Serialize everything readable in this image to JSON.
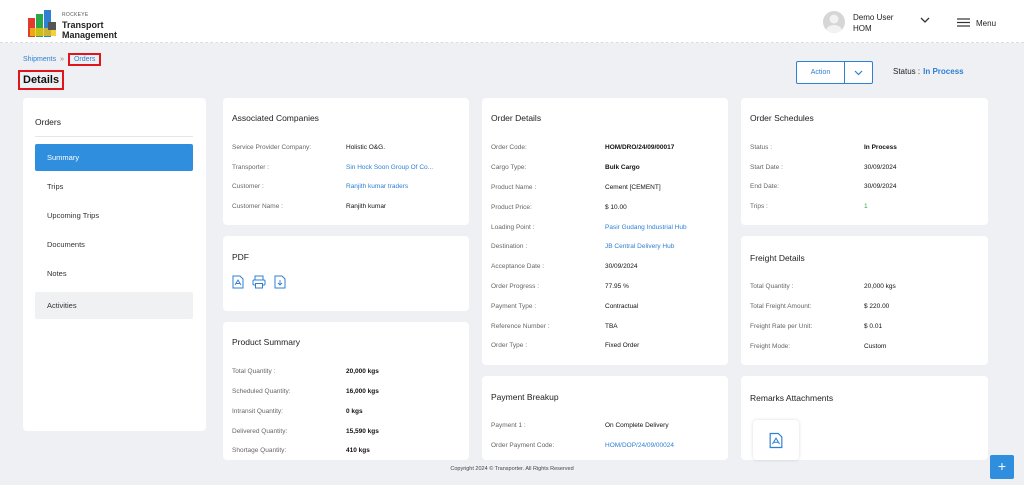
{
  "app": {
    "brand_small": "ROCKEYE",
    "brand_line1": "Transport",
    "brand_line2": "Management"
  },
  "user": {
    "name": "Demo User",
    "role": "HOM",
    "menu_label": "Menu"
  },
  "breadcrumb": {
    "root": "Shipments",
    "separator": "»",
    "current": "Orders"
  },
  "page": {
    "title": "Details",
    "action_label": "Action",
    "status_label": "Status :",
    "status_value": "In Process"
  },
  "sidebar": {
    "heading": "Orders",
    "items": [
      {
        "label": "Summary"
      },
      {
        "label": "Trips"
      },
      {
        "label": "Upcoming Trips"
      },
      {
        "label": "Documents"
      },
      {
        "label": "Notes"
      },
      {
        "label": "Activities"
      }
    ]
  },
  "associated": {
    "title": "Associated Companies",
    "rows": [
      {
        "label": "Service Provider Company:",
        "value": "Holistic O&G."
      },
      {
        "label": "Transporter :",
        "value": "Sin Hock Soon Group Of Co..."
      },
      {
        "label": "Customer :",
        "value": "Ranjith kumar traders"
      },
      {
        "label": "Customer Name :",
        "value": "Ranjith kumar"
      }
    ]
  },
  "pdf": {
    "title": "PDF"
  },
  "product_summary": {
    "title": "Product Summary",
    "rows": [
      {
        "label": "Total Quantity :",
        "value": "20,000 kgs"
      },
      {
        "label": "Scheduled Quantity:",
        "value": "16,000 kgs"
      },
      {
        "label": "Intransit Quantity:",
        "value": "0 kgs"
      },
      {
        "label": "Delivered Quantity:",
        "value": "15,590 kgs"
      },
      {
        "label": "Shortage Quantity:",
        "value": "410 kgs"
      }
    ]
  },
  "order_details": {
    "title": "Order Details",
    "rows": [
      {
        "label": "Order Code:",
        "value": "HOM/DRO/24/09/00017"
      },
      {
        "label": "Cargo Type:",
        "value": "Bulk Cargo"
      },
      {
        "label": "Product Name :",
        "value": "Cement [CEMENT]"
      },
      {
        "label": "Product Price:",
        "value": "$ 10.00"
      },
      {
        "label": "Loading Point :",
        "value": "Pasir Gudang Industrial Hub"
      },
      {
        "label": "Destination :",
        "value": "JB Central Delivery Hub"
      },
      {
        "label": "Acceptance Date :",
        "value": "30/09/2024"
      },
      {
        "label": "Order Progress :",
        "value": "77.95 %"
      },
      {
        "label": "Payment Type :",
        "value": "Contractual"
      },
      {
        "label": "Reference Number :",
        "value": "TBA"
      },
      {
        "label": "Order Type :",
        "value": "Fixed Order"
      }
    ]
  },
  "payment_breakup": {
    "title": "Payment Breakup",
    "rows": [
      {
        "label": "Payment 1 :",
        "value": "On Complete Delivery"
      },
      {
        "label": "Order Payment Code:",
        "value": "HOM/DOP/24/09/00024"
      }
    ]
  },
  "order_schedules": {
    "title": "Order Schedules",
    "rows": [
      {
        "label": "Status :",
        "value": "In Process"
      },
      {
        "label": "Start Date :",
        "value": "30/09/2024"
      },
      {
        "label": "End Date:",
        "value": "30/09/2024"
      },
      {
        "label": "Trips :",
        "value": "1"
      }
    ]
  },
  "freight_details": {
    "title": "Freight Details",
    "rows": [
      {
        "label": "Total Quantity :",
        "value": "20,000 kgs"
      },
      {
        "label": "Total Freight Amount:",
        "value": "$ 220.00"
      },
      {
        "label": "Freight Rate per Unit:",
        "value": "$ 0.01"
      },
      {
        "label": "Freight Mode:",
        "value": "Custom"
      }
    ]
  },
  "remarks": {
    "title": "Remarks Attachments"
  },
  "footer": {
    "copyright": "Copyright 2024 © Transporter. All Rights Reserved"
  },
  "fab": {
    "label": "+"
  },
  "colors": {
    "accent": "#2f8ede",
    "link": "#2f7fd3",
    "highlight": "#e0161d"
  }
}
